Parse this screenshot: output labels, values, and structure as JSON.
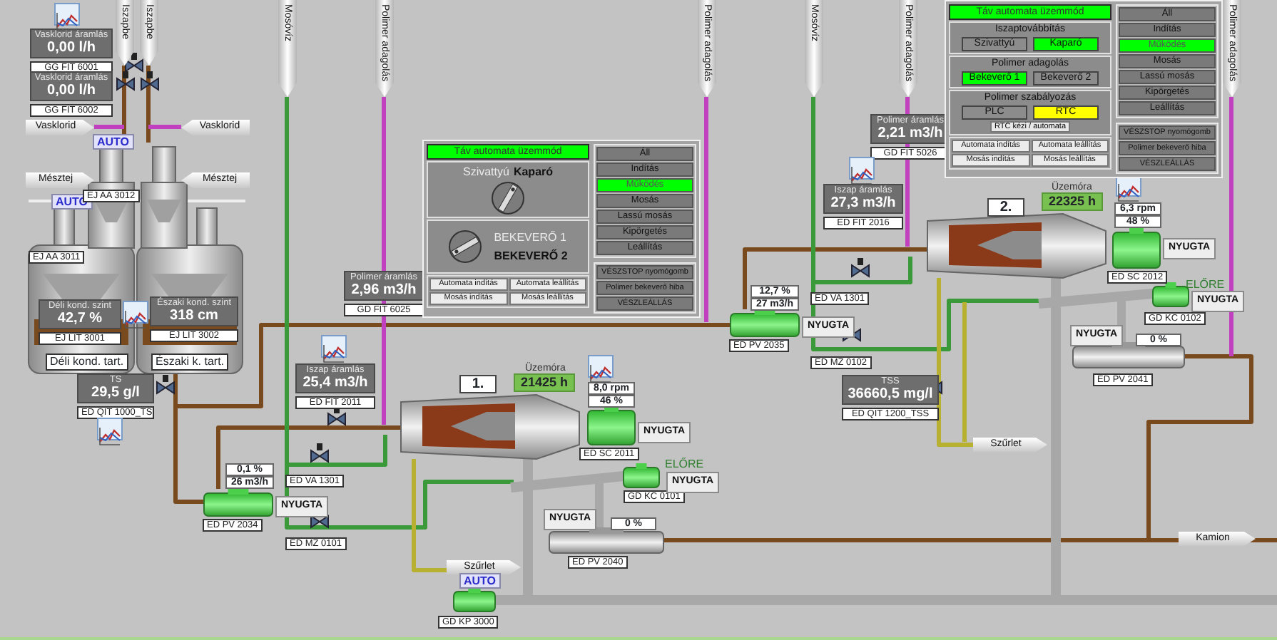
{
  "feed_lines": [
    {
      "label": "Iszapbe"
    },
    {
      "label": "Iszapbe"
    },
    {
      "label": "Mosóvíz"
    },
    {
      "label": "Polimer adagolás"
    },
    {
      "label": "Polimer adagolás"
    },
    {
      "label": "Mosóvíz"
    },
    {
      "label": "Polimer adagolás"
    },
    {
      "label": "Polimer adagolás"
    }
  ],
  "flow_arrows": [
    {
      "label": "Vasklorid"
    },
    {
      "label": "Vasklorid"
    },
    {
      "label": "Mésztej"
    },
    {
      "label": "Mésztej"
    },
    {
      "label": "Szűrlet"
    },
    {
      "label": "Szűrlet"
    },
    {
      "label": "Kamion"
    }
  ],
  "meters": [
    {
      "label": "Vasklorid áramlás",
      "value": "0,00 l/h",
      "tag": "GG FIT 6001"
    },
    {
      "label": "Vasklorid áramlás",
      "value": "0,00 l/h",
      "tag": "GG FIT 6002"
    },
    {
      "label": "Déli kond. szint",
      "value": "42,7 %",
      "tag": "EJ LIT 3001"
    },
    {
      "label": "Északi kond. szint",
      "value": "318 cm",
      "tag": "EJ LIT 3002"
    },
    {
      "label": "TS",
      "value": "29,5 g/l",
      "tag": "ED QIT 1000_TS"
    },
    {
      "label": "Polimer áramlás",
      "value": "2,96 m3/h",
      "tag": "GD FIT 6025"
    },
    {
      "label": "Iszap áramlás",
      "value": "25,4 m3/h",
      "tag": "ED FIT 2011"
    },
    {
      "label": "Polimer áramlás",
      "value": "2,21 m3/h",
      "tag": "GD FIT 5026"
    },
    {
      "label": "Iszap áramlás",
      "value": "27,3 m3/h",
      "tag": "ED FIT 2016"
    },
    {
      "label": "TSS",
      "value": "36660,5 mg/l",
      "tag": "ED QIT 1200_TSS"
    }
  ],
  "tanks": [
    {
      "name": "Déli kond. tart."
    },
    {
      "name": "Északi k. tart."
    }
  ],
  "auto_badges": [
    "AUTO",
    "AUTO",
    "AUTO"
  ],
  "equipment_tags": [
    "EJ AA 3012",
    "EJ AA 3011",
    "ED VA 1301",
    "ED MZ 0101",
    "ED PV 2034",
    "ED SC 2011",
    "GD KC 0101",
    "ED PV 2040",
    "GD KP 3000",
    "ED PV 2035",
    "ED VA 1301",
    "ED MZ 0102",
    "ED SC 2012",
    "GD KC 0102",
    "ED PV 2041"
  ],
  "status_labels": [
    "NYUGTA",
    "NYUGTA",
    "NYUGTA",
    "NYUGTA",
    "NYUGTA",
    "NYUGTA",
    "NYUGTA",
    "NYUGTA"
  ],
  "direction_labels": [
    "ELŐRE",
    "ELŐRE"
  ],
  "readouts": [
    "0,1 %",
    "26 m3/h",
    "0 %",
    "12,7 %",
    "27 m3/h",
    "0 %"
  ],
  "centrifuges": [
    {
      "number": "1.",
      "hours_label": "Üzemóra",
      "hours": "21425 h",
      "speed": "8,0 rpm",
      "load": "46 %"
    },
    {
      "number": "2.",
      "hours_label": "Üzemóra",
      "hours": "22325 h",
      "speed": "6,3 rpm",
      "load": "48 %"
    }
  ],
  "panels": [
    {
      "kind": "knobs",
      "mode": "Táv automata üzemmód",
      "selectors": [
        {
          "options": [
            {
              "label": "Szivattyú",
              "selected": false
            },
            {
              "label": "Kaparó",
              "selected": true
            }
          ]
        },
        {
          "options": [
            {
              "label": "BEKEVERŐ 1",
              "selected": false
            },
            {
              "label": "BEKEVERŐ 2",
              "selected": true
            }
          ]
        }
      ],
      "buttons": [
        "Automata indítás",
        "Automata leállítás",
        "Mosás indítás",
        "Mosás leállítás"
      ],
      "states": [
        {
          "label": "Áll",
          "active": false
        },
        {
          "label": "Indítás",
          "active": false
        },
        {
          "label": "Működés",
          "active": true
        },
        {
          "label": "Mosás",
          "active": false
        },
        {
          "label": "Lassú mosás",
          "active": false
        },
        {
          "label": "Kipörgetés",
          "active": false
        },
        {
          "label": "Leállítás",
          "active": false
        }
      ],
      "alarms": [
        "VÉSZSTOP nyomógomb",
        "Polimer bekeverő hiba",
        "VÉSZLEÁLLÁS"
      ]
    },
    {
      "kind": "toggles",
      "mode": "Táv automata üzemmód",
      "selectors": [
        {
          "title": "Iszaptovábbítás",
          "color": "#00ff00",
          "options": [
            {
              "label": "Szivattyú",
              "selected": false
            },
            {
              "label": "Kaparó",
              "selected": true
            }
          ]
        },
        {
          "title": "Polimer adagolás",
          "color": "#00ff00",
          "options": [
            {
              "label": "Bekeverő 1",
              "selected": true
            },
            {
              "label": "Bekeverő 2",
              "selected": false
            }
          ]
        },
        {
          "title": "Polimer szabályozás",
          "color": "#ffff00",
          "options": [
            {
              "label": "PLC",
              "selected": false
            },
            {
              "label": "RTC",
              "selected": true
            }
          ]
        }
      ],
      "mode_button": "RTC kézi / automata",
      "buttons": [
        "Automata indítás",
        "Automata leállítás",
        "Mosás indítás",
        "Mosás leállítás"
      ],
      "states": [
        {
          "label": "Áll",
          "active": false
        },
        {
          "label": "Indítás",
          "active": false
        },
        {
          "label": "Működés",
          "active": true
        },
        {
          "label": "Mosás",
          "active": false
        },
        {
          "label": "Lassú mosás",
          "active": false
        },
        {
          "label": "Kipörgetés",
          "active": false
        },
        {
          "label": "Leállítás",
          "active": false
        }
      ],
      "alarms": [
        "VÉSZSTOP nyomógomb",
        "Polimer bekeverő hiba",
        "VÉSZLEÁLLÁS"
      ]
    }
  ]
}
